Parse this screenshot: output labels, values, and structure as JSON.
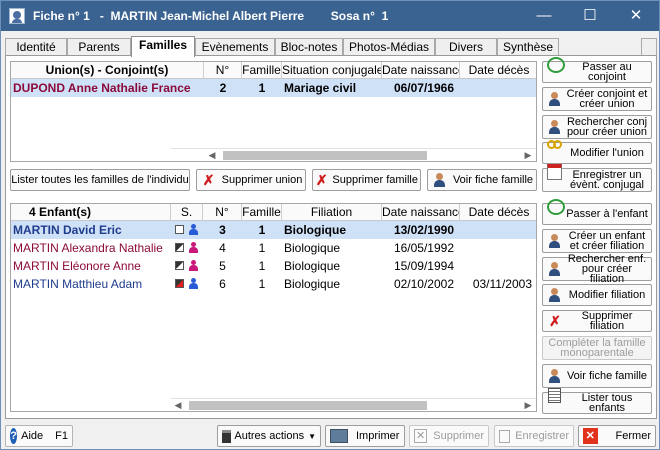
{
  "window": {
    "title": "Fiche n° 1   -  MARTIN Jean-Michel Albert Pierre        Sosa n°  1",
    "titlebar_color": "#3a6391"
  },
  "tabs": [
    "Identité",
    "Parents",
    "Familles",
    "Evènements",
    "Bloc-notes",
    "Photos-Médias",
    "Divers",
    "Synthèse"
  ],
  "active_tab": "Familles",
  "unions": {
    "headers": [
      "Union(s) - Conjoint(s)",
      "N°",
      "Famille",
      "Situation conjugale",
      "Date naissance",
      "Date décès"
    ],
    "rows": [
      {
        "name": "DUPOND Anne Nathalie France",
        "num": "2",
        "famille": "1",
        "situation": "Mariage civil",
        "naissance": "06/07/1966",
        "deces": ""
      }
    ],
    "name_color": "#8b0a3a"
  },
  "union_buttons": {
    "list_all": "Lister toutes les familles de l'individu",
    "delete_union": "Supprimer union",
    "delete_family": "Supprimer famille",
    "view_family": "Voir fiche famille"
  },
  "children": {
    "headers": [
      "4  Enfant(s)",
      "S.",
      "N°",
      "Famille",
      "Filiation",
      "Date naissance",
      "Date décès"
    ],
    "rows": [
      {
        "name": "MARTIN David Eric",
        "flag": "empty",
        "sex": "M",
        "num": "3",
        "famille": "1",
        "filiation": "Biologique",
        "naissance": "13/02/1990",
        "deces": "",
        "color": "#1f3b8c"
      },
      {
        "name": "MARTIN Alexandra Nathalie",
        "flag": "gray",
        "sex": "F",
        "num": "4",
        "famille": "1",
        "filiation": "Biologique",
        "naissance": "16/05/1992",
        "deces": "",
        "color": "#8b0a3a"
      },
      {
        "name": "MARTIN Eléonore Anne",
        "flag": "gray",
        "sex": "F",
        "num": "5",
        "famille": "1",
        "filiation": "Biologique",
        "naissance": "15/09/1994",
        "deces": "",
        "color": "#8b0a3a"
      },
      {
        "name": "MARTIN Matthieu Adam",
        "flag": "red",
        "sex": "M",
        "num": "6",
        "famille": "1",
        "filiation": "Biologique",
        "naissance": "02/10/2002",
        "deces": "03/11/2003",
        "color": "#1f3b8c"
      }
    ]
  },
  "side_buttons_top": [
    {
      "label": "Passer au conjoint",
      "icon": "refresh-icon"
    },
    {
      "label": "Créer conjoint et créer union",
      "icon": "person-add-icon"
    },
    {
      "label": "Rechercher conj pour créer union",
      "icon": "person-search-icon"
    },
    {
      "label": "Modifier l'union",
      "icon": "rings-icon"
    },
    {
      "label": "Enregistrer un évènt. conjugal",
      "icon": "calendar-icon"
    }
  ],
  "side_buttons_bottom": [
    {
      "label": "Passer à l'enfant",
      "icon": "refresh-icon",
      "disabled": false
    },
    {
      "label": "Créer un enfant et créer filiation",
      "icon": "person-add-icon",
      "disabled": false
    },
    {
      "label": "Rechercher enf. pour créer filiation",
      "icon": "person-search-icon",
      "disabled": false
    },
    {
      "label": "Modifier filiation",
      "icon": "person-icon",
      "disabled": false
    },
    {
      "label": "Supprimer filiation",
      "icon": "person-delete-icon",
      "disabled": false
    },
    {
      "label": "Compléter la famille monoparentale",
      "icon": "",
      "disabled": true
    },
    {
      "label": "Voir fiche famille",
      "icon": "family-icon",
      "disabled": false
    },
    {
      "label": "Lister tous enfants",
      "icon": "list-icon",
      "disabled": false
    }
  ],
  "bottom": {
    "help": "Aide",
    "help_key": "F1",
    "other_actions": "Autres actions",
    "print": "Imprimer",
    "delete": "Supprimer",
    "save": "Enregistrer",
    "close": "Fermer"
  }
}
